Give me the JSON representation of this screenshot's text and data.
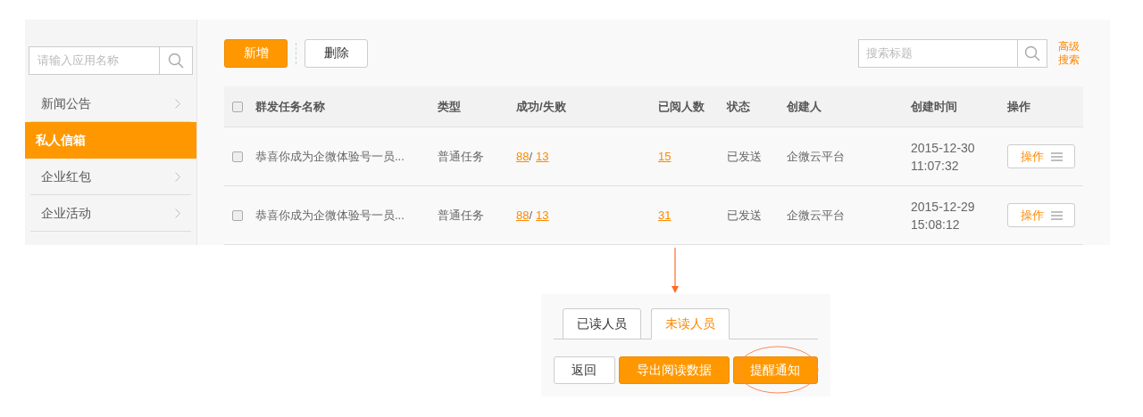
{
  "sidebar": {
    "search": {
      "placeholder": "请输入应用名称"
    },
    "items": [
      {
        "label": "新闻公告",
        "selected": false
      },
      {
        "label": "私人信箱",
        "selected": true
      },
      {
        "label": "企业红包",
        "selected": false
      },
      {
        "label": "企业活动",
        "selected": false
      }
    ]
  },
  "toolbar": {
    "buttons": [
      {
        "label": "新增",
        "kind": "primary"
      },
      {
        "label": "删除",
        "kind": "plain"
      }
    ],
    "search": {
      "placeholder": "搜索标题"
    },
    "advanced_link": "高级搜索"
  },
  "table": {
    "all_checked": false,
    "columns": [
      "群发任务名称",
      "类型",
      "成功/失败",
      "已阅人数",
      "状态",
      "创建人",
      "创建时间",
      "操作"
    ],
    "rows": [
      {
        "checked": false,
        "name": "恭喜你成为企微体验号一员...",
        "type": "普通任务",
        "success": "88",
        "separator": "/",
        "fail": "13",
        "read": "15",
        "status": "已发送",
        "creator": "企微云平台",
        "date": "2015-12-30",
        "time": "11:07:32",
        "action": "操作"
      },
      {
        "checked": false,
        "name": "恭喜你成为企微体验号一员...",
        "type": "普通任务",
        "success": "88",
        "separator": "/",
        "fail": "13",
        "read": "31",
        "status": "已发送",
        "creator": "企微云平台",
        "date": "2015-12-29",
        "time": "15:08:12",
        "action": "操作"
      }
    ]
  },
  "detail": {
    "tabs": [
      {
        "label": "已读人员",
        "selected": false
      },
      {
        "label": "未读人员",
        "selected": true
      }
    ],
    "buttons": [
      {
        "label": "返回",
        "kind": "plain"
      },
      {
        "label": "导出阅读数据",
        "kind": "primary"
      },
      {
        "label": "提醒通知",
        "kind": "primary"
      }
    ]
  }
}
